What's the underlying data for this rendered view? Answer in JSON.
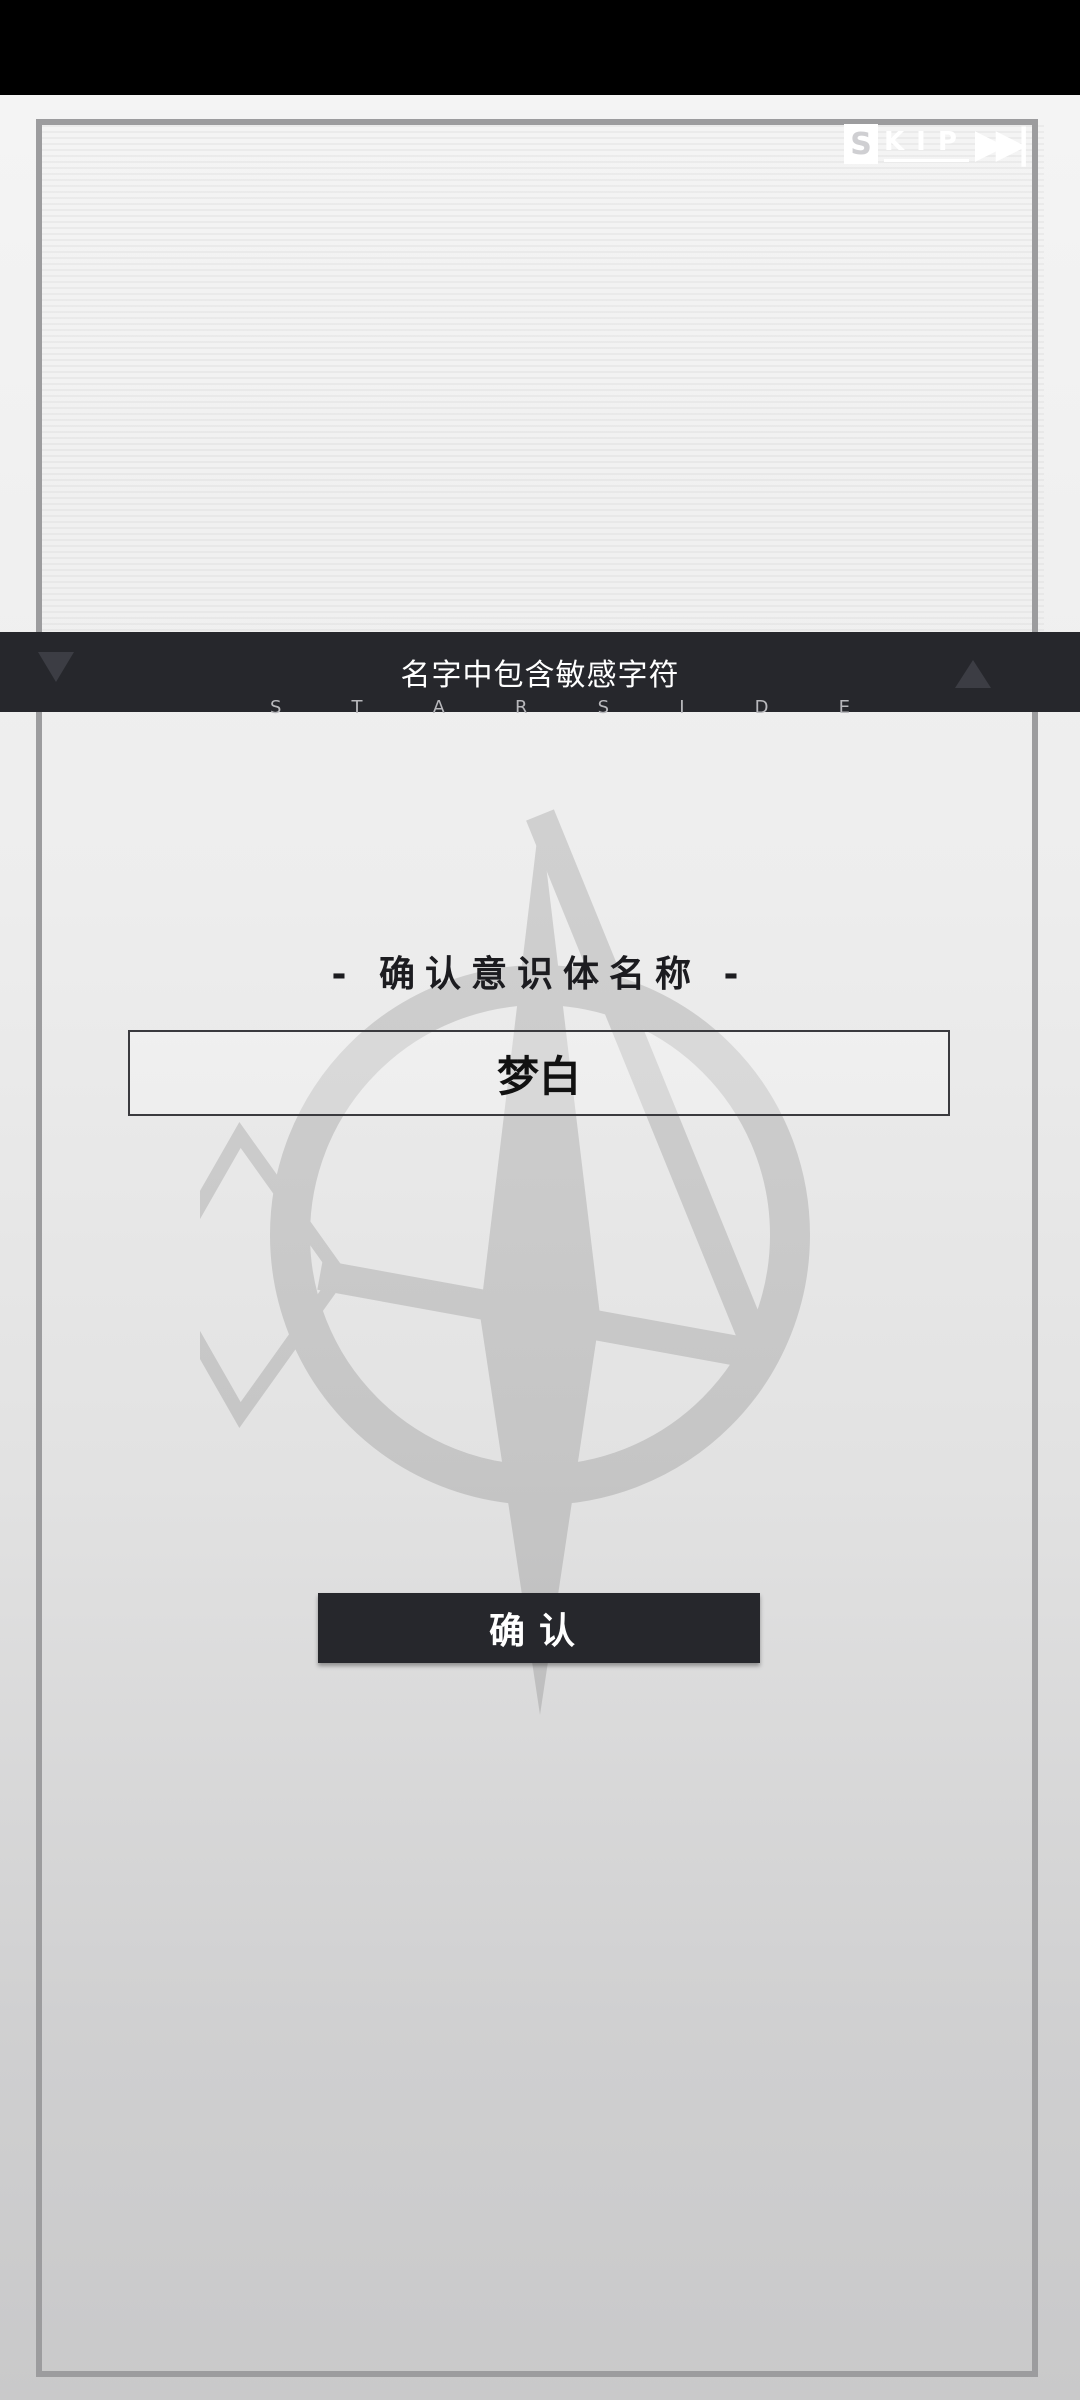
{
  "top_bar": {
    "skip_letter": "S",
    "skip_label": "KIP",
    "skip_arrows": "▶▶|"
  },
  "banner": {
    "message": "名字中包含敏感字符",
    "subtitle_letters": [
      "S",
      "T",
      "A",
      "R",
      "S",
      "I",
      "D",
      "E"
    ]
  },
  "dialog": {
    "title": "- 确认意识体名称 -",
    "name_value": "梦白",
    "confirm_label": "确认"
  },
  "colors": {
    "banner_bg": "#26272c",
    "button_bg": "#26272c",
    "frame": "#9c9c9e"
  }
}
